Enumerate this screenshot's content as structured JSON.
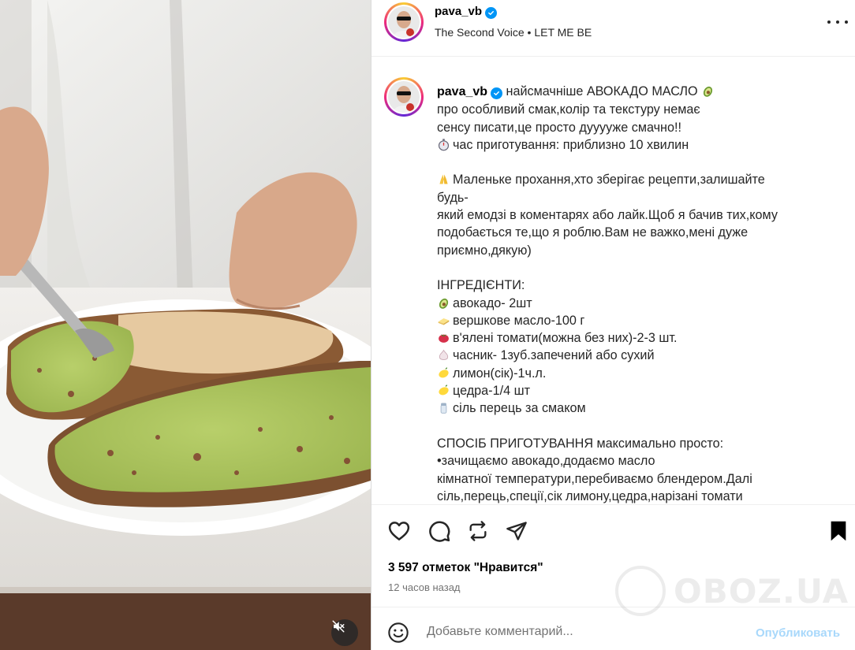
{
  "post": {
    "username": "pava_vb",
    "music": "The Second Voice",
    "music_separator": "•",
    "song": "LET ME BE"
  },
  "caption": {
    "username": "pava_vb",
    "line1": "найсмачніше АВОКАДО МАСЛО",
    "line2": "про особливий смак,колір та текстуру немає",
    "line3": "сенсу писати,це просто дууууже смачно!!",
    "line4": "час приготування: приблизно 10 хвилин",
    "para2": "Маленьке прохання,хто зберігає рецепти,залишайте будь-\nякий емодзі в коментарях або лайк.Щоб я бачив тих,кому\nподобається те,що я роблю.Вам не важко,мені дуже\nприємно,дякую)",
    "ingredients_title": "ІНГРЕДІЄНТИ:",
    "ingredients": [
      {
        "icon": "avocado-icon",
        "text": "авокадо- 2шт"
      },
      {
        "icon": "butter-icon",
        "text": "вершкове масло-100 г"
      },
      {
        "icon": "tomato-icon",
        "text": "в'ялені томати(можна без них)-2-3 шт."
      },
      {
        "icon": "garlic-icon",
        "text": "часник- 1зуб.запечений або сухий"
      },
      {
        "icon": "lemon-icon",
        "text": "лимон(сік)-1ч.л."
      },
      {
        "icon": "lemon-icon",
        "text": "цедра-1/4 шт"
      },
      {
        "icon": "salt-icon",
        "text": "сіль перець за смаком"
      }
    ],
    "method_title": "СПОСІБ ПРИГОТУВАННЯ максимально просто:",
    "method": "•зачищаємо авокадо,додаємо масло\nкімнатної температури,перебиваємо блендером.Далі\nсіль,перець,спеції,сік лимону,цедра,нарізані томати\nперемішуємо і ставимо в холодильник,щоб застигло і можемо"
  },
  "stats": {
    "likes": "3 597 отметок \"Нравится\"",
    "time_ago": "12 часов назад"
  },
  "comment": {
    "placeholder": "Добавьте комментарий...",
    "publish_label": "Опубликовать"
  },
  "watermark": {
    "text": "OBOZ.UA"
  },
  "colors": {
    "verified": "#0095f6",
    "publish_disabled": "#a8d8fb",
    "secondary_text": "#737373"
  }
}
